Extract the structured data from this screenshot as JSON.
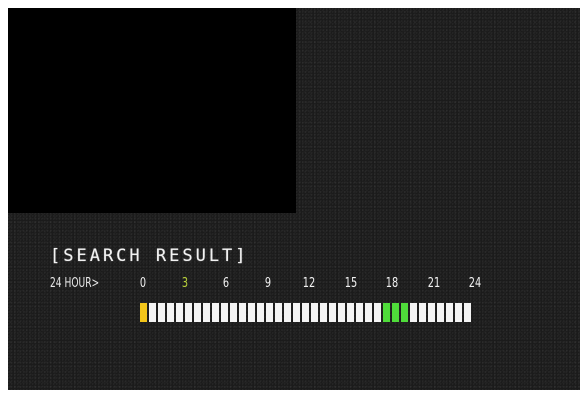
{
  "screen": {
    "title": "[SEARCH RESULT]",
    "period_label": "24 HOUR>"
  },
  "timeline": {
    "ticks": [
      {
        "label": "0",
        "color": "#f2f2f2"
      },
      {
        "label": "3",
        "color": "#b8d03a"
      },
      {
        "label": "6",
        "color": "#f2f2f2"
      },
      {
        "label": "9",
        "color": "#f2f2f2"
      },
      {
        "label": "12",
        "color": "#f2f2f2"
      },
      {
        "label": "15",
        "color": "#f2f2f2"
      },
      {
        "label": "18",
        "color": "#f2f2f2"
      },
      {
        "label": "21",
        "color": "#f2f2f2"
      },
      {
        "label": "24",
        "color": "#f2f2f2"
      }
    ],
    "slot_count": 37,
    "hours_per_slot": 0.65,
    "segments": [
      {
        "index": 0,
        "type": "alarm",
        "color": "#f2c51a"
      },
      {
        "index": 27,
        "type": "motion",
        "color": "#4fdc3a"
      },
      {
        "index": 28,
        "type": "motion",
        "color": "#4fdc3a"
      },
      {
        "index": 29,
        "type": "motion",
        "color": "#4fdc3a"
      }
    ],
    "default_color": "#f4f4f4"
  }
}
